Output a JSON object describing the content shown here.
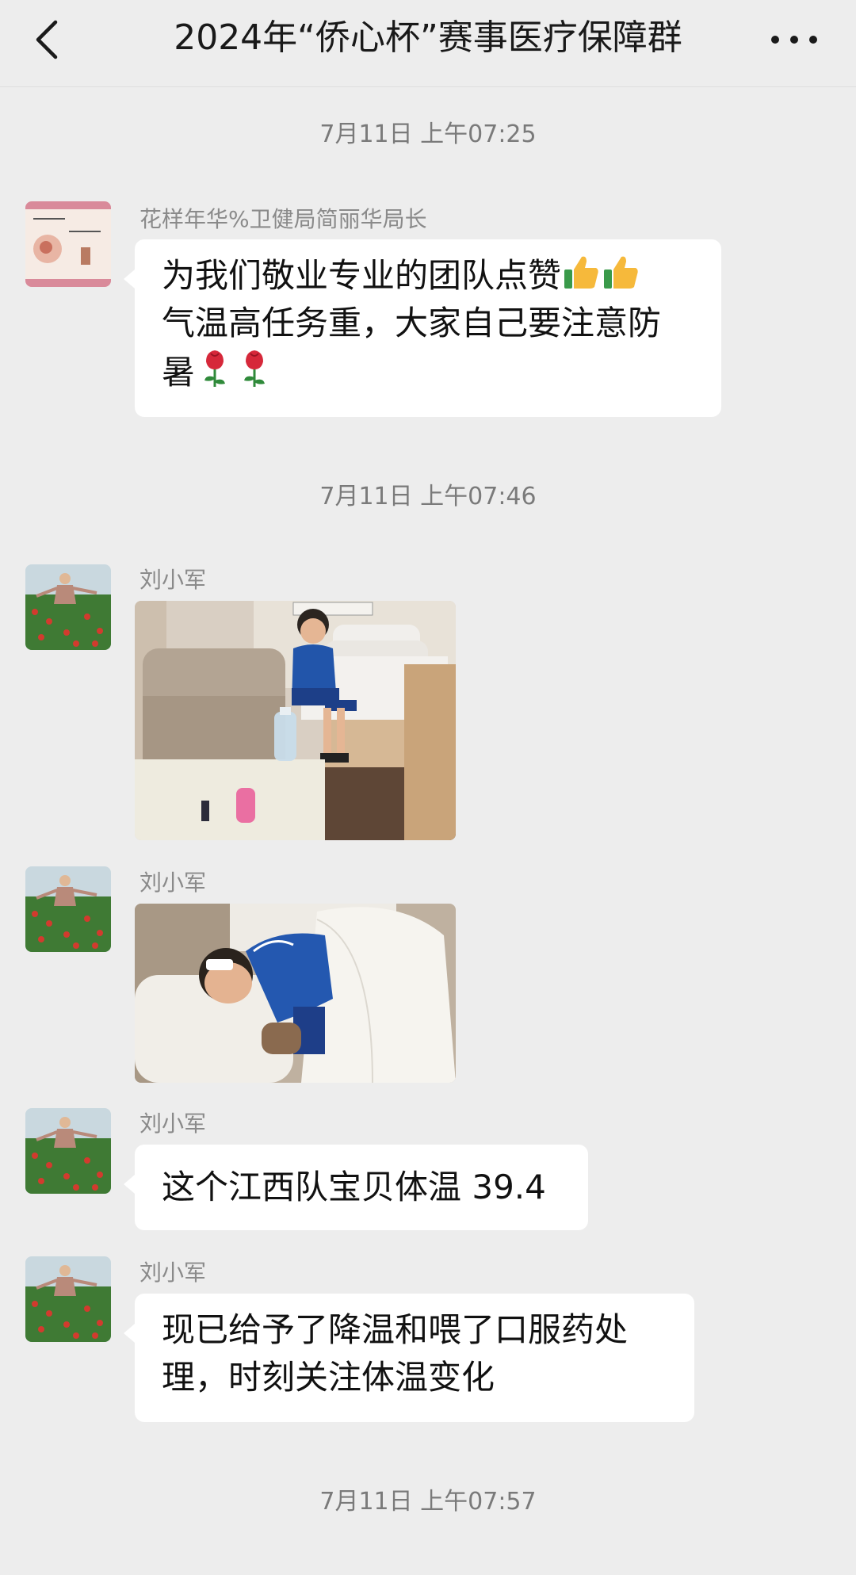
{
  "header": {
    "title": "2024年“侨心杯”赛事医疗保障群",
    "back_icon": "chevron-left-icon",
    "more_icon": "more-dots-icon"
  },
  "timestamps": [
    "7月11日 上午07:25",
    "7月11日 上午07:46",
    "7月11日 上午07:57"
  ],
  "messages": [
    {
      "sender": "花样年华%卫健局简丽华局长",
      "lines": [
        "为我们敬业专业的团队点赞",
        "气温高任务重，大家自己要注意防",
        "暑"
      ],
      "emojis": [
        "thumbs-up-icon",
        "thumbs-up-icon",
        "rose-icon",
        "rose-icon"
      ]
    },
    {
      "sender": "刘小军",
      "type": "image",
      "content": "photo-boy-sitting-on-bed"
    },
    {
      "sender": "刘小军",
      "type": "image",
      "content": "photo-boy-sleeping"
    },
    {
      "sender": "刘小军",
      "lines": [
        "这个江西队宝贝体温 39.4"
      ]
    },
    {
      "sender": "刘小军",
      "lines": [
        "现已给予了降温和喂了口服药处",
        "理，时刻关注体温变化"
      ]
    }
  ],
  "colors": {
    "background": "#ededed",
    "bubble": "#ffffff",
    "text": "#111111",
    "meta_text": "#7a7a7a"
  }
}
